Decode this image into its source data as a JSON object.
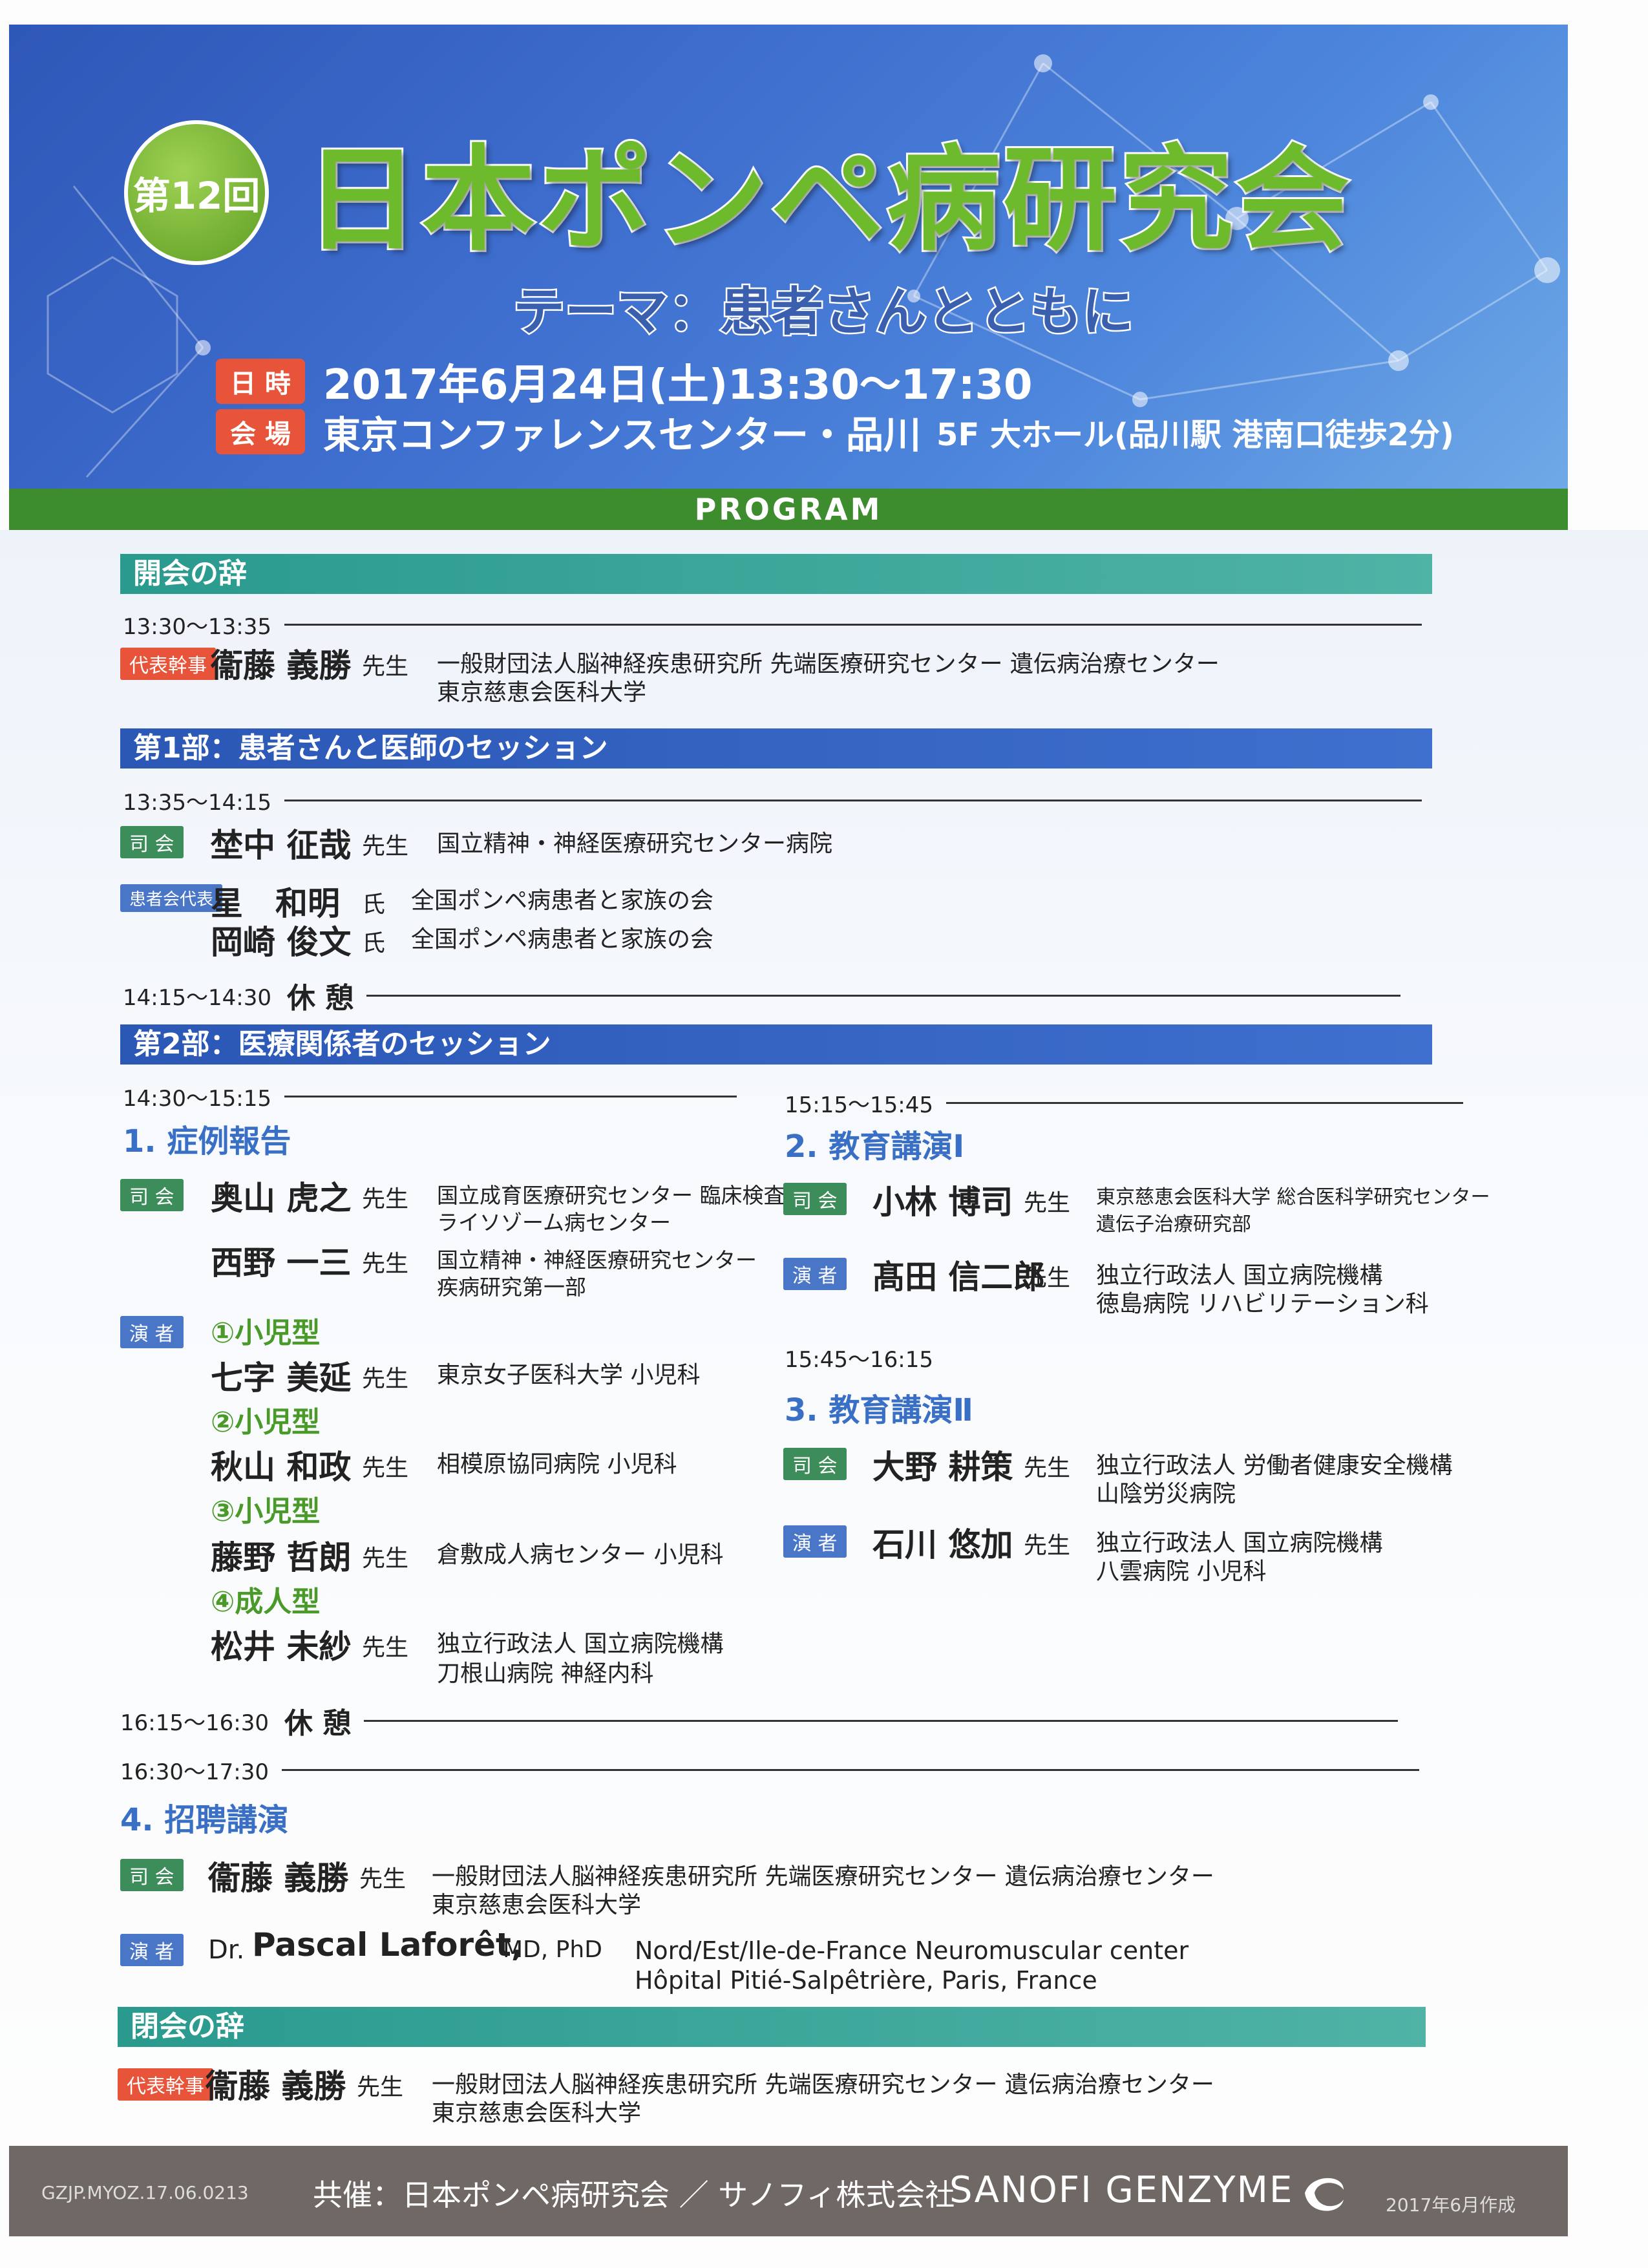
{
  "header": {
    "badge": "第12回",
    "title": "日本ポンペ病研究会",
    "theme": "テーマ：患者さんとともに",
    "date_tag": "日 時",
    "date_text": "2017年6月24日(土)13:30〜17:30",
    "venue_tag": "会 場",
    "venue_main": "東京コンファレンスセンター・品川",
    "venue_sub": "5F 大ホール(品川駅 港南口徒歩2分)",
    "program": "PROGRAM"
  },
  "opening": {
    "title": "開会の辞",
    "time": "13:30〜13:35",
    "tag": "代表幹事",
    "name": "衞藤 義勝",
    "honorific": "先生",
    "aff1": "一般財団法人脳神経疾患研究所 先端医療研究センター 遺伝病治療センター",
    "aff2": "東京慈恵会医科大学"
  },
  "part1": {
    "title": "第1部：患者さんと医師のセッション",
    "time": "13:35〜14:15",
    "chair_tag": "司 会",
    "chair_name": "埜中 征哉",
    "chair_hon": "先生",
    "chair_aff": "国立精神・神経医療研究センター病院",
    "rep_tag": "患者会代表",
    "rep1_name": "星　和明",
    "rep1_hon": "氏",
    "rep1_aff": "全国ポンペ病患者と家族の会",
    "rep2_name": "岡崎 俊文",
    "rep2_hon": "氏",
    "rep2_aff": "全国ポンペ病患者と家族の会"
  },
  "break1": {
    "time": "14:15〜14:30",
    "label": "休 憩"
  },
  "part2": {
    "title": "第2部：医療関係者のセッション",
    "s1_time": "14:30〜15:15",
    "s1_title": "1. 症例報告",
    "s1_chair_tag": "司 会",
    "s1_chair1_name": "奥山 虎之",
    "s1_chair1_hon": "先生",
    "s1_chair1_aff1": "国立成育医療研究センター 臨床検査部/",
    "s1_chair1_aff2": "ライソゾーム病センター",
    "s1_chair2_name": "西野 一三",
    "s1_chair2_hon": "先生",
    "s1_chair2_aff1": "国立精神・神経医療研究センター",
    "s1_chair2_aff2": "疾病研究第一部",
    "s1_sp_tag": "演 者",
    "type1": "①小児型",
    "sp1_name": "七字 美延",
    "sp1_hon": "先生",
    "sp1_aff": "東京女子医科大学 小児科",
    "type2": "②小児型",
    "sp2_name": "秋山 和政",
    "sp2_hon": "先生",
    "sp2_aff": "相模原協同病院 小児科",
    "type3": "③小児型",
    "sp3_name": "藤野 哲朗",
    "sp3_hon": "先生",
    "sp3_aff": "倉敷成人病センター 小児科",
    "type4": "④成人型",
    "sp4_name": "松井 未紗",
    "sp4_hon": "先生",
    "sp4_aff1": "独立行政法人 国立病院機構",
    "sp4_aff2": "刀根山病院 神経内科",
    "s2_time": "15:15〜15:45",
    "s2_title": "2. 教育講演Ⅰ",
    "s2_chair_tag": "司 会",
    "s2_chair_name": "小林 博司",
    "s2_chair_hon": "先生",
    "s2_chair_aff1": "東京慈恵会医科大学 総合医科学研究センター",
    "s2_chair_aff2": "遺伝子治療研究部",
    "s2_sp_tag": "演 者",
    "s2_sp_name": "髙田 信二郎",
    "s2_sp_hon": "先生",
    "s2_sp_aff1": "独立行政法人 国立病院機構",
    "s2_sp_aff2": "徳島病院 リハビリテーション科",
    "s3_time": "15:45〜16:15",
    "s3_title": "3. 教育講演Ⅱ",
    "s3_chair_tag": "司 会",
    "s3_chair_name": "大野 耕策",
    "s3_chair_hon": "先生",
    "s3_chair_aff1": "独立行政法人 労働者健康安全機構",
    "s3_chair_aff2": "山陰労災病院",
    "s3_sp_tag": "演 者",
    "s3_sp_name": "石川 悠加",
    "s3_sp_hon": "先生",
    "s3_sp_aff1": "独立行政法人 国立病院機構",
    "s3_sp_aff2": "八雲病院 小児科"
  },
  "break2": {
    "time": "16:15〜16:30",
    "label": "休 憩"
  },
  "part4": {
    "time": "16:30〜17:30",
    "title": "4. 招聘講演",
    "chair_tag": "司 会",
    "chair_name": "衞藤 義勝",
    "chair_hon": "先生",
    "chair_aff1": "一般財団法人脳神経疾患研究所 先端医療研究センター 遺伝病治療センター",
    "chair_aff2": "東京慈恵会医科大学",
    "sp_tag": "演 者",
    "sp_prefix": "Dr.",
    "sp_name": "Pascal Laforêt,",
    "sp_degree": "MD, PhD",
    "sp_aff1": "Nord/Est/Ile-de-France Neuromuscular center",
    "sp_aff2": "Hôpital Pitié-Salpêtrière, Paris, France"
  },
  "closing": {
    "title": "閉会の辞",
    "tag": "代表幹事",
    "name": "衞藤 義勝",
    "honorific": "先生",
    "aff1": "一般財団法人脳神経疾患研究所 先端医療研究センター 遺伝病治療センター",
    "aff2": "東京慈恵会医科大学"
  },
  "footer": {
    "code": "GZJP.MYOZ.17.06.0213",
    "host": "共催：日本ポンペ病研究会 ／ サノフィ株式会社",
    "logo": "SANOFI GENZYME",
    "date": "2017年6月作成"
  },
  "colors": {
    "header_blue": "#3f6fcf",
    "title_green": "#6dbb2c",
    "program_green": "#3d8d2f",
    "teal": "#2a9a8e",
    "accent_red": "#e8543a",
    "footer_gray": "#6f6864"
  }
}
